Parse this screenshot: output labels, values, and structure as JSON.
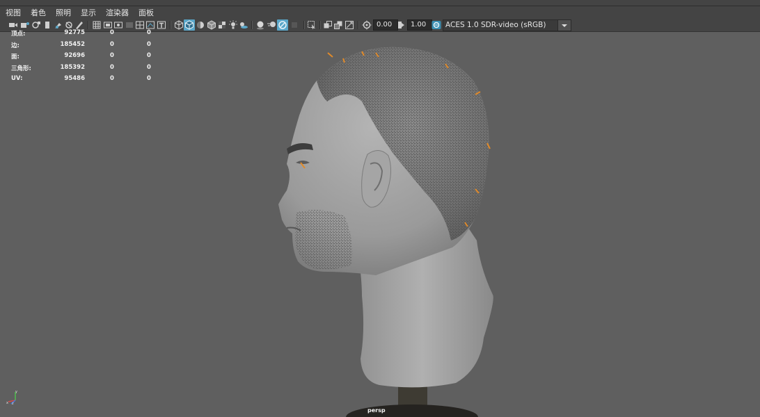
{
  "menu": [
    {
      "label": "视图"
    },
    {
      "label": "着色"
    },
    {
      "label": "照明"
    },
    {
      "label": "显示"
    },
    {
      "label": "渲染器"
    },
    {
      "label": "面板"
    }
  ],
  "toolbar": {
    "exposure_value": "0.00",
    "gamma_value": "1.00",
    "color_space": "ACES 1.0 SDR-video (sRGB)",
    "accent_color": "#5aa7c9"
  },
  "stats": [
    {
      "label": "顶点:",
      "total": "92775",
      "selected": "0",
      "sub": "0"
    },
    {
      "label": "边:",
      "total": "185452",
      "selected": "0",
      "sub": "0"
    },
    {
      "label": "面:",
      "total": "92696",
      "selected": "0",
      "sub": "0"
    },
    {
      "label": "三角形:",
      "total": "185392",
      "selected": "0",
      "sub": "0"
    },
    {
      "label": "UV:",
      "total": "95486",
      "selected": "0",
      "sub": "0"
    }
  ],
  "viewport": {
    "camera": "persp",
    "axis_x": "x",
    "axis_y": "y",
    "axis_z": "z"
  }
}
